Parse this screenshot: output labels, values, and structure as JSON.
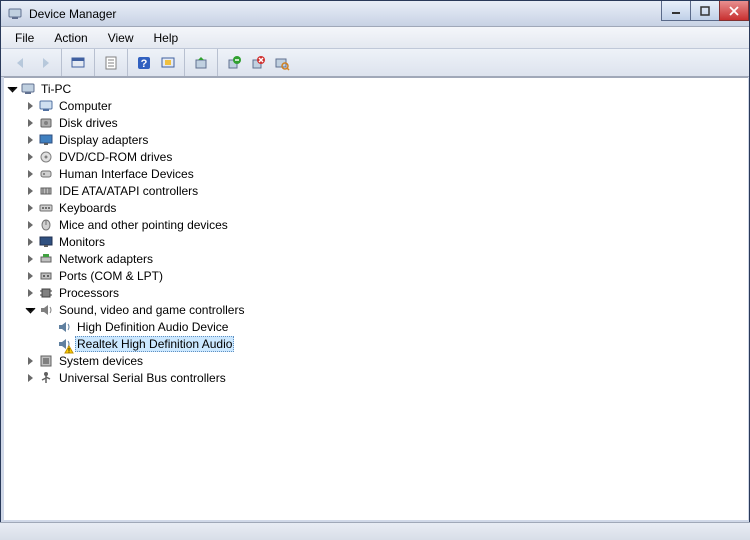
{
  "window": {
    "title": "Device Manager"
  },
  "menu": {
    "file": "File",
    "action": "Action",
    "view": "View",
    "help": "Help"
  },
  "toolbar": {
    "back": "Back",
    "forward": "Forward",
    "show_hidden": "Show hidden devices",
    "properties": "Properties",
    "help": "Help",
    "refresh": "Refresh",
    "update_driver": "Update Driver Software",
    "uninstall": "Uninstall",
    "disable": "Disable",
    "scan": "Scan for hardware changes"
  },
  "root": {
    "label": "Ti-PC"
  },
  "categories": [
    {
      "label": "Computer",
      "icon": "computer-icon",
      "expanded": false
    },
    {
      "label": "Disk drives",
      "icon": "disk-icon",
      "expanded": false
    },
    {
      "label": "Display adapters",
      "icon": "display-icon",
      "expanded": false
    },
    {
      "label": "DVD/CD-ROM drives",
      "icon": "dvd-icon",
      "expanded": false
    },
    {
      "label": "Human Interface Devices",
      "icon": "hid-icon",
      "expanded": false
    },
    {
      "label": "IDE ATA/ATAPI controllers",
      "icon": "ide-icon",
      "expanded": false
    },
    {
      "label": "Keyboards",
      "icon": "keyboard-icon",
      "expanded": false
    },
    {
      "label": "Mice and other pointing devices",
      "icon": "mouse-icon",
      "expanded": false
    },
    {
      "label": "Monitors",
      "icon": "monitor-icon",
      "expanded": false
    },
    {
      "label": "Network adapters",
      "icon": "network-icon",
      "expanded": false
    },
    {
      "label": "Ports (COM & LPT)",
      "icon": "port-icon",
      "expanded": false
    },
    {
      "label": "Processors",
      "icon": "cpu-icon",
      "expanded": false
    },
    {
      "label": "Sound, video and game controllers",
      "icon": "sound-icon",
      "expanded": true,
      "children": [
        {
          "label": "High Definition Audio Device",
          "icon": "speaker-icon",
          "warn": false,
          "selected": false
        },
        {
          "label": "Realtek High Definition Audio",
          "icon": "speaker-icon",
          "warn": true,
          "selected": true
        }
      ]
    },
    {
      "label": "System devices",
      "icon": "system-icon",
      "expanded": false
    },
    {
      "label": "Universal Serial Bus controllers",
      "icon": "usb-icon",
      "expanded": false
    }
  ]
}
